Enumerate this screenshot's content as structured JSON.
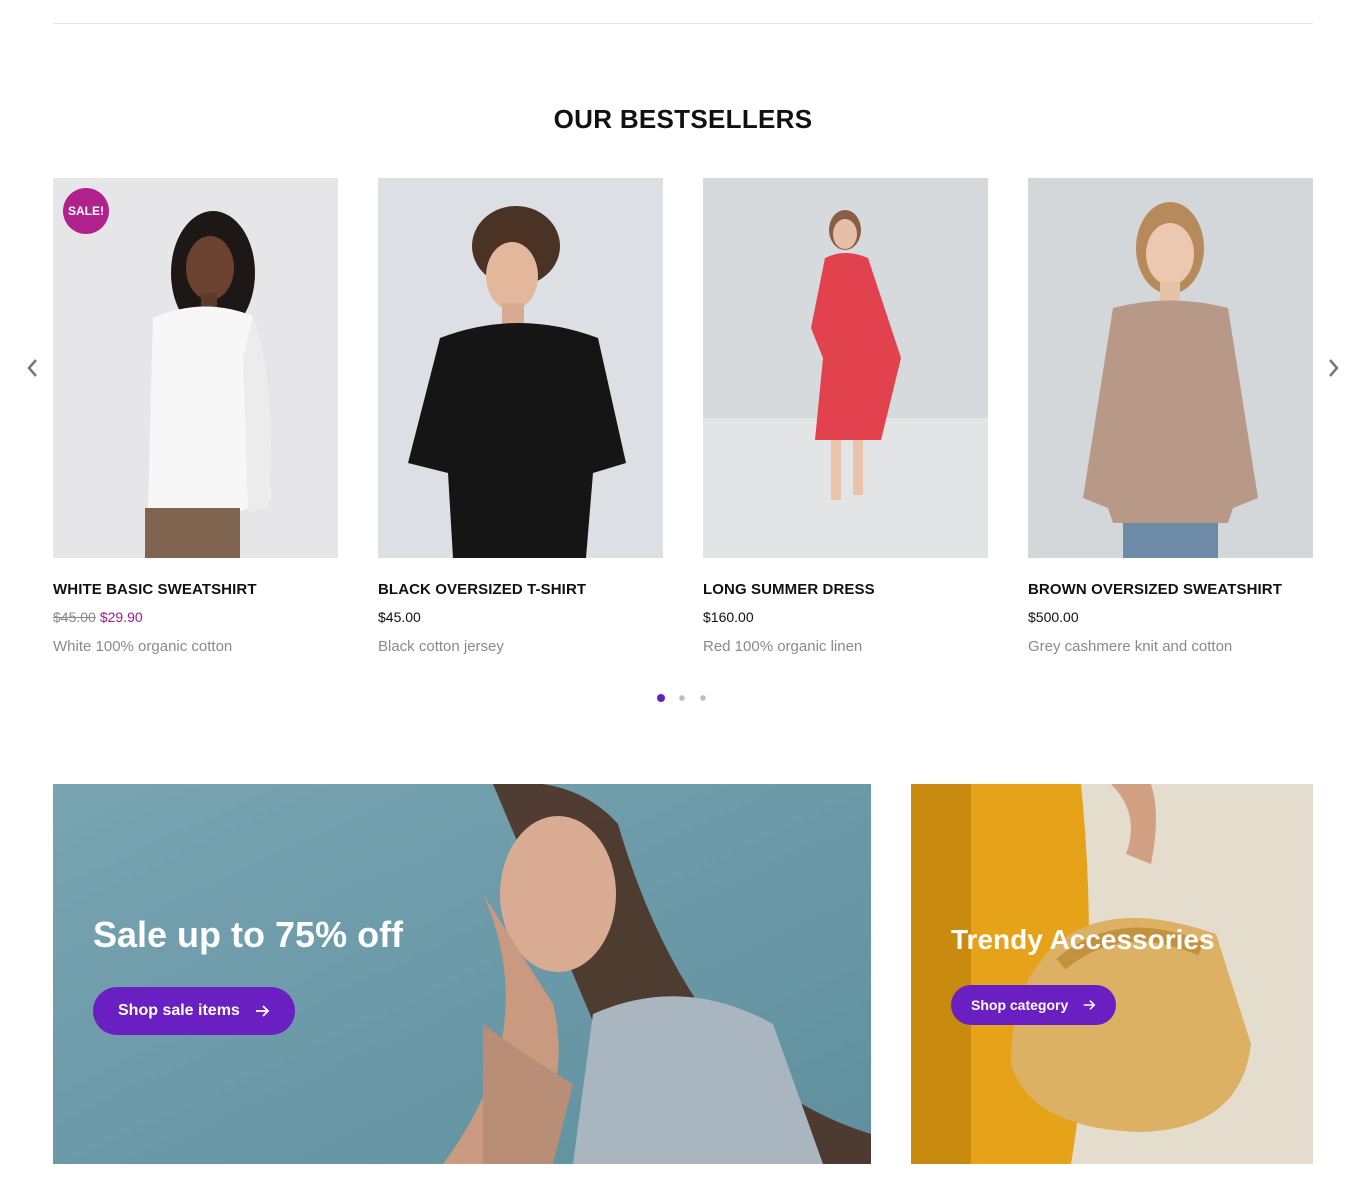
{
  "section": {
    "title": "OUR BESTSELLERS"
  },
  "carousel": {
    "prev_icon": "chevron-left-icon",
    "next_icon": "chevron-right-icon",
    "pages": 3,
    "active_page": 1
  },
  "products": [
    {
      "name": "WHITE BASIC SWEATSHIRT",
      "price_old": "$45.00",
      "price": "$29.90",
      "description": "White 100% organic cotton",
      "badge": "SALE!"
    },
    {
      "name": "BLACK OVERSIZED T-SHIRT",
      "price": "$45.00",
      "description": "Black cotton jersey"
    },
    {
      "name": "LONG SUMMER DRESS",
      "price": "$160.00",
      "description": "Red 100% organic linen"
    },
    {
      "name": "BROWN OVERSIZED SWEATSHIRT",
      "price": "$500.00",
      "description": "Grey cashmere knit and cotton"
    }
  ],
  "banners": {
    "sale": {
      "title": "Sale up to 75% off",
      "button": "Shop sale items"
    },
    "accessories": {
      "title": "Trendy Accessories",
      "button": "Shop category"
    }
  },
  "colors": {
    "accent": "#6a1fc2",
    "sale": "#b0218c",
    "muted": "#8a8a8a"
  }
}
